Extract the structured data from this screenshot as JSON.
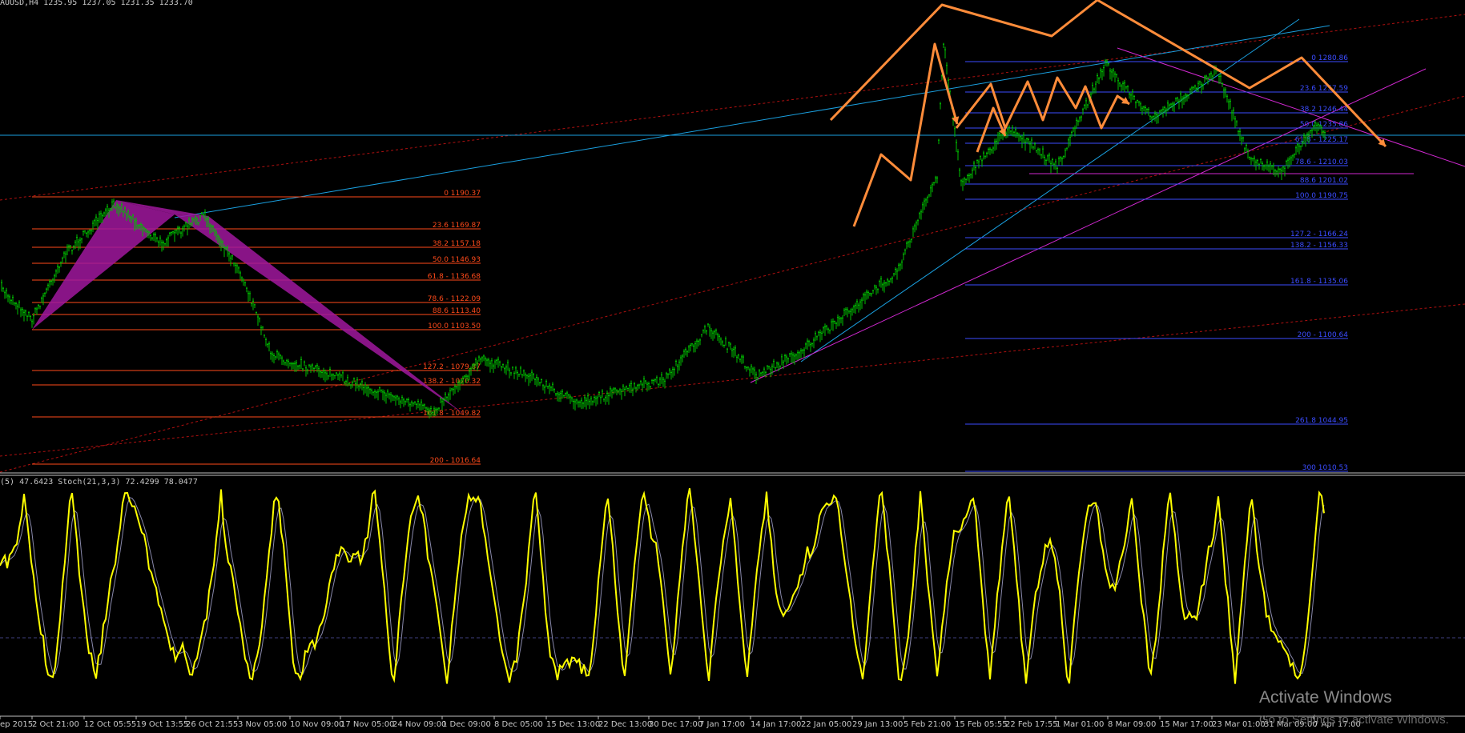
{
  "header": {
    "symbol_ohlc": "AUUSD,H4  1235.95 1237.05 1231.35 1233.70",
    "indicator_line": "(5) 47.6423  Stoch(21,3,3) 72.4299 78.0477"
  },
  "time_axis": [
    "ep 2015",
    "2 Oct 21:00",
    "12 Oct 05:55",
    "19 Oct 13:55",
    "26 Oct 21:55",
    "3 Nov 05:00",
    "10 Nov 09:00",
    "17 Nov 05:00",
    "24 Nov 09:00",
    "1 Dec 09:00",
    "8 Dec 05:00",
    "15 Dec 13:00",
    "22 Dec 13:00",
    "30 Dec 17:00",
    "7 Jan 17:00",
    "14 Jan 17:00",
    "22 Jan 05:00",
    "29 Jan 13:00",
    "5 Feb 21:00",
    "15 Feb 05:55",
    "22 Feb 17:55",
    "1 Mar 01:00",
    "8 Mar 09:00",
    "15 Mar 17:00",
    "23 Mar 01:00",
    "31 Mar 09:00",
    "7 Apr 17:00"
  ],
  "fib_left": [
    "0 1190.37",
    "23.6 1169.87",
    "38.2 1157.18",
    "50.0 1146.93",
    "61.8 - 1136.68",
    "78.6 - 1122.09",
    "88.6 1113.40",
    "100.0 1103.50",
    "127.2 - 1079.87",
    "138.2 - 1070.32",
    "161.8 - 1049.82",
    "200 - 1016.64"
  ],
  "fib_right": [
    "0 1280.86",
    "23.6 1257.59",
    "38.2 1246.44",
    "50.0 1235.86",
    "61.8 - 1225.17",
    "78.6 - 1210.03",
    "88.6 1201.02",
    "100.0 1190.75",
    "127.2 - 1166.24",
    "138.2 - 1156.33",
    "161.8 - 1135.06",
    "200 - 1100.64",
    "261.8 1044.95",
    "300 1010.53"
  ],
  "watermark": {
    "title": "Activate Windows",
    "subtitle": "Go to Settings to activate Windows."
  },
  "colors": {
    "background": "#000000",
    "candles": "#00c000",
    "fib_left": "#ff4a1a",
    "fib_right": "#3b4cff",
    "pattern_fill": "#a0189e",
    "arrows": "#ff8c3a",
    "trend_cyan": "#1aa0e0",
    "trend_magenta": "#d028d0",
    "channel_red": "#b01010",
    "stoch_main": "#ffff00",
    "stoch_signal": "#8888aa"
  },
  "chart_data": [
    {
      "type": "line",
      "name": "price",
      "x": [
        "Sep 2015",
        "Oct 2015",
        "Nov 2015",
        "Dec 2015",
        "Jan 2016",
        "Feb 2016",
        "Mar 2016",
        "Apr 2016"
      ],
      "y": [
        1130,
        1170,
        1090,
        1065,
        1095,
        1210,
        1240,
        1233
      ],
      "fib_left_levels": [
        1190.37,
        1169.87,
        1157.18,
        1146.93,
        1136.68,
        1122.09,
        1113.4,
        1103.5,
        1079.87,
        1070.32,
        1049.82,
        1016.64
      ],
      "fib_right_levels": [
        1280.86,
        1257.59,
        1246.44,
        1235.86,
        1225.17,
        1210.03,
        1201.02,
        1190.75,
        1166.24,
        1156.33,
        1135.06,
        1100.64,
        1044.95,
        1010.53
      ]
    },
    {
      "type": "line",
      "name": "stochastic",
      "params": "Stoch(21,3,3)",
      "last_main": 72.4299,
      "last_signal": 78.0477,
      "ylim": [
        0,
        100
      ]
    }
  ]
}
